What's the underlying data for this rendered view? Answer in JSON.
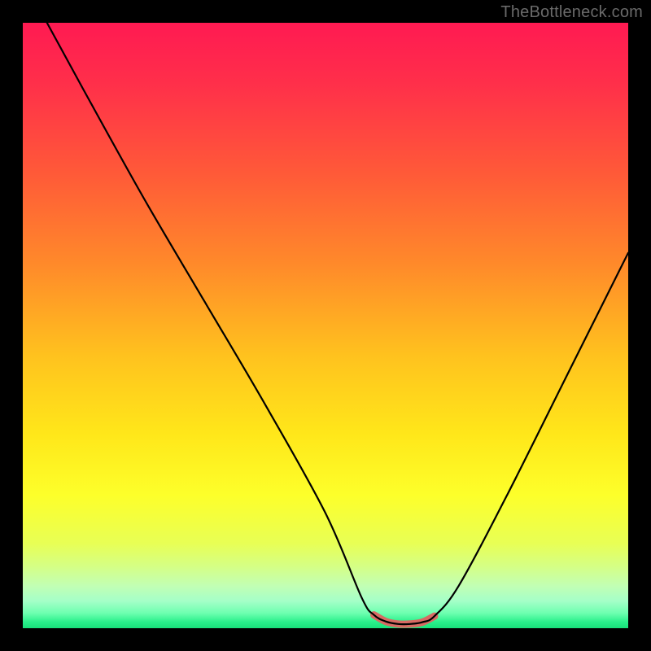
{
  "watermark": "TheBottleneck.com",
  "colors": {
    "frame": "#000000",
    "watermark": "#6a6a6a",
    "curve_main": "#000000",
    "curve_accent": "#d86a63",
    "gradient_stops": [
      {
        "offset": 0.0,
        "color": "#ff1a52"
      },
      {
        "offset": 0.1,
        "color": "#ff2f4a"
      },
      {
        "offset": 0.25,
        "color": "#ff5a38"
      },
      {
        "offset": 0.4,
        "color": "#ff8a2a"
      },
      {
        "offset": 0.55,
        "color": "#ffc21e"
      },
      {
        "offset": 0.68,
        "color": "#ffe71a"
      },
      {
        "offset": 0.78,
        "color": "#fdff2a"
      },
      {
        "offset": 0.86,
        "color": "#e8ff55"
      },
      {
        "offset": 0.9,
        "color": "#d4ff88"
      },
      {
        "offset": 0.93,
        "color": "#c2ffb4"
      },
      {
        "offset": 0.955,
        "color": "#a5ffc8"
      },
      {
        "offset": 0.975,
        "color": "#6effb0"
      },
      {
        "offset": 0.99,
        "color": "#28f08a"
      },
      {
        "offset": 1.0,
        "color": "#18e07a"
      }
    ]
  },
  "chart_data": {
    "type": "line",
    "title": "",
    "xlabel": "",
    "ylabel": "",
    "xlim": [
      0,
      100
    ],
    "ylim": [
      0,
      100
    ],
    "legend": false,
    "annotations": [],
    "accent_range_x": [
      56.5,
      68
    ],
    "series": [
      {
        "name": "bottleneck-curve",
        "x": [
          4,
          10,
          20,
          30,
          40,
          50,
          56,
          58,
          60,
          62,
          64,
          66,
          68,
          72,
          80,
          90,
          100
        ],
        "y": [
          100,
          89,
          71,
          54,
          37,
          19,
          5,
          2.2,
          1.1,
          0.7,
          0.7,
          1.0,
          2.0,
          7,
          22,
          42,
          62
        ]
      }
    ]
  }
}
